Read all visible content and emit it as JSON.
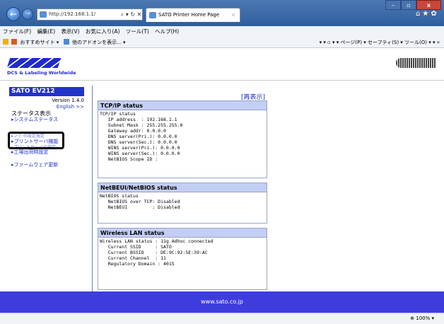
{
  "browser": {
    "address": "http://192.168.1.1/",
    "address_controls": "⌕ ▾ ↻ ✕",
    "tab_title": "SATO Printer Home Page",
    "tab_close": "×",
    "win_min": "–",
    "win_max": "▫",
    "win_close": "x",
    "tb_icons": "⌂★✿",
    "menu": [
      "ファイル(F)",
      "編集(E)",
      "表示(V)",
      "お気に入り(A)",
      "ツール(T)",
      "ヘルプ(H)"
    ],
    "favorites": [
      "おすすめサイト ▾",
      "他のアドオンを表示... ▾"
    ],
    "commands": "▾  ▾ ▫ ▾  ▾  ページ(P) ▾  セーフティ(S) ▾  ツール(O) ▾  ▾  »",
    "zoom": "100%  ▾"
  },
  "banner": {
    "logo_sub": "DCS & Labeling Worldwide"
  },
  "sidebar": {
    "model": "SATO EV212",
    "version": "Version 1.4.0",
    "english": "English >>",
    "status_heading": "ステータス表示",
    "links": [
      "▸システムステータス",
      "▸プリントサーバ機能",
      "▸工場出荷時設定",
      "▸ファームウェア更新"
    ],
    "occluded_top": "▸ンツ  の設定規定",
    "occluded_bottom": "▸プリントサーバの設定"
  },
  "main": {
    "reload": "[再表示]",
    "tcpip": {
      "title": "TCP/IP status",
      "body": "TCP/IP status\n   IP address  : 192.168.1.1\n   Subnet Mask : 255.255.255.0\n   Gateway addr: 0.0.0.0\n   DNS server(Pri.): 0.0.0.0\n   DNS server(Sec.): 0.0.0.0\n   WINS server(Pri.): 0.0.0.0\n   WINS server(Sec.): 0.0.0.0\n   NetBIOS Scope ID :"
    },
    "netbeui": {
      "title": "NetBEUI/NetBIOS status",
      "body": "NetBIOS status\n   NetBIOS over TCP: Disabled\n   NetBEUI         : Disabled"
    },
    "wlan": {
      "title": "Wireless LAN status",
      "body": "Wireless LAN status : 11g Adhoc connected\n   Current SSID     : SATO\n   Current BSSID    : DE:9C:92:5E:39:AC\n   Current Channel  : 11\n   Regulatory Domain : 4015"
    }
  },
  "footer": {
    "url": "www.sato.co.jp"
  }
}
